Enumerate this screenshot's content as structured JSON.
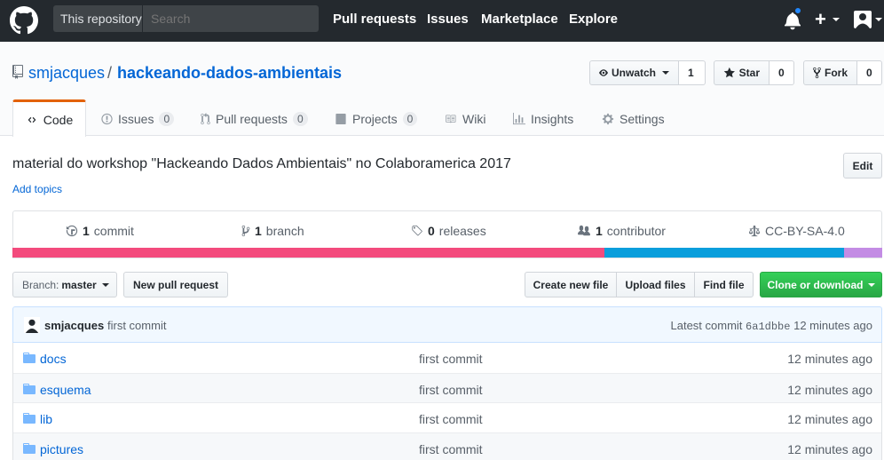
{
  "header": {
    "scope_label": "This repository",
    "search_placeholder": "Search",
    "nav": [
      "Pull requests",
      "Issues",
      "Marketplace",
      "Explore"
    ],
    "plus": "+"
  },
  "repo": {
    "owner": "smjacques",
    "separator": "/",
    "name": "hackeando-dados-ambientais",
    "watch_label": "Unwatch",
    "watch_count": "1",
    "star_label": "Star",
    "star_count": "0",
    "fork_label": "Fork",
    "fork_count": "0"
  },
  "tabs": [
    {
      "label": "Code",
      "count": ""
    },
    {
      "label": "Issues",
      "count": "0"
    },
    {
      "label": "Pull requests",
      "count": "0"
    },
    {
      "label": "Projects",
      "count": "0"
    },
    {
      "label": "Wiki",
      "count": ""
    },
    {
      "label": "Insights",
      "count": ""
    },
    {
      "label": "Settings",
      "count": ""
    }
  ],
  "description": "material do workshop \"Hackeando Dados Ambientais\" no Colaboramerica 2017",
  "add_topics": "Add topics",
  "edit_label": "Edit",
  "summary": {
    "commits_num": "1",
    "commits_label": "commit",
    "branches_num": "1",
    "branches_label": "branch",
    "releases_num": "0",
    "releases_label": "releases",
    "contributors_num": "1",
    "contributors_label": "contributor",
    "license": "CC-BY-SA-4.0"
  },
  "languages": [
    {
      "color": "#f34b7d",
      "share": 0.681
    },
    {
      "color": "#0a9edc",
      "share": 0.275
    },
    {
      "color": "#c38ce4",
      "share": 0.044
    }
  ],
  "filenav": {
    "branch_prefix": "Branch:",
    "branch": "master",
    "new_pr": "New pull request",
    "create_file": "Create new file",
    "upload_files": "Upload files",
    "find_file": "Find file",
    "clone": "Clone or download"
  },
  "latest_commit": {
    "author": "smjacques",
    "message": "first commit",
    "prefix": "Latest commit",
    "sha": "6a1dbbe",
    "age": "12 minutes ago"
  },
  "files": [
    {
      "name": "docs",
      "message": "first commit",
      "age": "12 minutes ago"
    },
    {
      "name": "esquema",
      "message": "first commit",
      "age": "12 minutes ago"
    },
    {
      "name": "lib",
      "message": "first commit",
      "age": "12 minutes ago"
    },
    {
      "name": "pictures",
      "message": "first commit",
      "age": "12 minutes ago"
    }
  ]
}
